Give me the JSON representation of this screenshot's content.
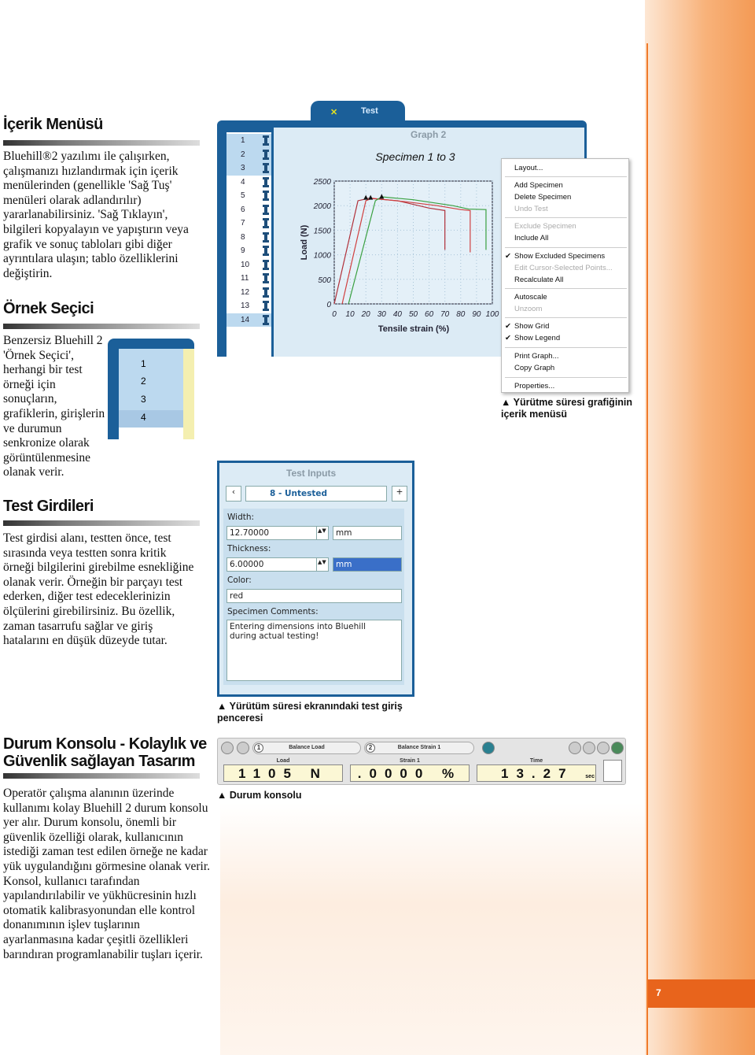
{
  "page_number": "7",
  "sections": [
    {
      "title": "İçerik Menüsü",
      "text": "Bluehill®2 yazılımı ile çalışırken, çalışmanızı hızlandırmak için içerik menülerinden (genellikle 'Sağ Tuş' menüleri olarak adlandırılır) yararlanabilirsiniz. 'Sağ Tıklayın', bilgileri kopyalayın ve yapıştırın veya grafik ve sonuç tabloları gibi diğer ayrıntılara ulaşın; tablo özelliklerini değiştirin."
    },
    {
      "title": "Örnek Seçici",
      "text": "Benzersiz Bluehill 2 'Örnek Seçici', herhangi bir test örneği için sonuçların, grafiklerin, girişlerin ve durumun senkronize olarak görüntülenmesine olanak verir."
    },
    {
      "title": "Test Girdileri",
      "text": "Test girdisi alanı, testten önce, test sırasında veya testten sonra kritik örneği bilgilerini girebilme esnekliğine olanak verir. Örneğin bir parçayı test ederken, diğer test edeceklerinizin ölçülerini girebilirsiniz. Bu özellik, zaman tasarrufu sağlar ve giriş hatalarını en düşük düzeyde tutar."
    },
    {
      "title": "Durum Konsolu - Kolaylık ve Güvenlik sağlayan Tasarım",
      "text": "Operatör çalışma alanının üzerinde kullanımı kolay Bluehill 2 durum konsolu yer alır. Durum konsolu, önemli bir güvenlik özelliği olarak, kullanıcının istediği zaman test edilen örneğe ne kadar yük uygulandığını görmesine olanak verir. Konsol, kullanıcı tarafından yapılandırılabilir ve yükhücresinin hızlı otomatik kalibrasyonundan elle kontrol donanımının işlev tuşlarının ayarlanmasına kadar çeşitli özellikleri barındıran programlanabilir tuşları içerir."
    }
  ],
  "small_selector": {
    "rows": [
      "1",
      "2",
      "3",
      "4"
    ],
    "selected": "4"
  },
  "graph_window": {
    "tab": "Test",
    "pane_title": "Graph 2",
    "specimens": [
      "1",
      "2",
      "3",
      "4",
      "5",
      "6",
      "7",
      "8",
      "9",
      "10",
      "11",
      "12",
      "13",
      "14"
    ],
    "selected_specimens": [
      "1",
      "2",
      "3",
      "14"
    ],
    "context_menu": {
      "items": [
        {
          "label": "Layout...",
          "enabled": true
        },
        {
          "label": "Add Specimen",
          "enabled": true
        },
        {
          "label": "Delete Specimen",
          "enabled": true
        },
        {
          "label": "Undo Test",
          "enabled": false
        },
        {
          "label": "Exclude Specimen",
          "enabled": false
        },
        {
          "label": "Include All",
          "enabled": true
        },
        {
          "label": "Show Excluded Specimens",
          "enabled": true,
          "checked": true
        },
        {
          "label": "Edit Cursor-Selected Points...",
          "enabled": false
        },
        {
          "label": "Recalculate All",
          "enabled": true
        },
        {
          "label": "Autoscale",
          "enabled": true
        },
        {
          "label": "Unzoom",
          "enabled": false
        },
        {
          "label": "Show Grid",
          "enabled": true,
          "checked": true
        },
        {
          "label": "Show Legend",
          "enabled": true,
          "checked": true
        },
        {
          "label": "Print Graph...",
          "enabled": true
        },
        {
          "label": "Copy Graph",
          "enabled": true
        },
        {
          "label": "Properties...",
          "enabled": true
        }
      ]
    },
    "caption": "▲ Yürütme süresi grafiğinin içerik menüsü"
  },
  "chart_data": {
    "type": "line",
    "title": "Specimen 1 to 3",
    "xlabel": "Tensile strain (%)",
    "ylabel": "Load (N)",
    "xlim": [
      0,
      100
    ],
    "ylim": [
      0,
      2500
    ],
    "xticks": [
      "0",
      "10",
      "20",
      "30",
      "40",
      "50",
      "60",
      "70",
      "80",
      "90",
      "100"
    ],
    "yticks": [
      "0",
      "500",
      "1000",
      "1500",
      "2000",
      "2500"
    ],
    "grid": true,
    "series": [
      {
        "color": "#b0303a",
        "x": [
          0,
          15,
          22,
          40,
          60,
          70,
          70
        ],
        "y": [
          0,
          2100,
          2150,
          2100,
          1950,
          1900,
          1100
        ]
      },
      {
        "color": "#d04040",
        "x": [
          5,
          20,
          24,
          45,
          65,
          80,
          86,
          86
        ],
        "y": [
          0,
          2100,
          2150,
          2080,
          2000,
          1920,
          1900,
          1050
        ]
      },
      {
        "color": "#3aa040",
        "x": [
          9,
          26,
          30,
          50,
          75,
          85,
          96,
          96
        ],
        "y": [
          0,
          2100,
          2180,
          2120,
          2000,
          1930,
          1920,
          1100
        ]
      }
    ],
    "markers": [
      {
        "x": 20,
        "y": 2170
      },
      {
        "x": 23,
        "y": 2170
      },
      {
        "x": 30,
        "y": 2190
      }
    ]
  },
  "test_inputs": {
    "title": "Test Inputs",
    "current_specimen": "8 - Untested",
    "width_label": "Width:",
    "width_value": "12.70000",
    "width_unit": "mm",
    "thickness_label": "Thickness:",
    "thickness_value": "6.00000",
    "thickness_unit": "mm",
    "color_label": "Color:",
    "color_value": "red",
    "comments_label": "Specimen Comments:",
    "comments_value": "Entering dimensions into Bluehill during actual testing!",
    "caption": "▲ Yürütüm süresi ekranındaki test giriş penceresi"
  },
  "console": {
    "button1": {
      "num": "1",
      "label": "Balance Load"
    },
    "button2": {
      "num": "2",
      "label": "Balance Strain 1"
    },
    "readouts": [
      {
        "label": "Load",
        "value": "1105 N"
      },
      {
        "label": "Strain 1",
        "value": ".0000 %"
      },
      {
        "label": "Time",
        "value": "13.27",
        "unit": "sec"
      }
    ],
    "caption": "▲ Durum konsolu"
  },
  "colors": {
    "accent_orange": "#e8641c",
    "window_blue": "#1b5f99",
    "pane_blue": "#dcebf5"
  }
}
